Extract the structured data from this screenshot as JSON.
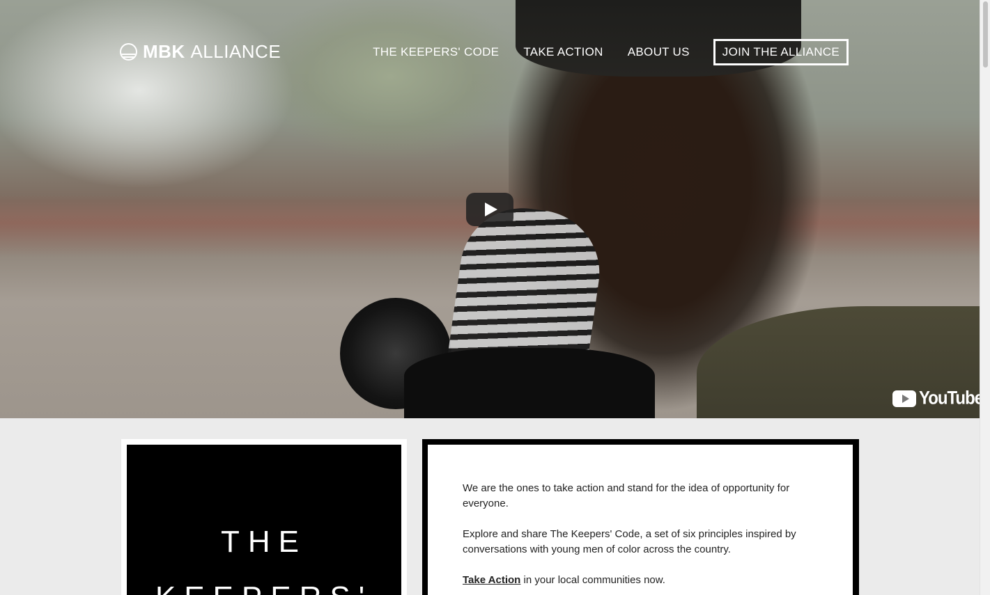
{
  "header": {
    "logo": {
      "bold": "MBK",
      "light": "ALLIANCE"
    },
    "nav": [
      {
        "label": "THE KEEPERS' CODE"
      },
      {
        "label": "TAKE ACTION"
      },
      {
        "label": "ABOUT US"
      }
    ],
    "join_label": "JOIN THE ALLIANCE"
  },
  "video": {
    "play_icon": "play-icon",
    "provider": "YouTube"
  },
  "keepers_card": {
    "line1": "THE",
    "line2": "KEEPERS'"
  },
  "intro": {
    "p1": "We are the ones to take action and stand for the idea of opportunity for everyone.",
    "p2": "Explore and share The Keepers' Code, a set of six principles inspired by conversations with young men of color across the country.",
    "p3_link": "Take Action",
    "p3_rest": " in your local communities now."
  }
}
